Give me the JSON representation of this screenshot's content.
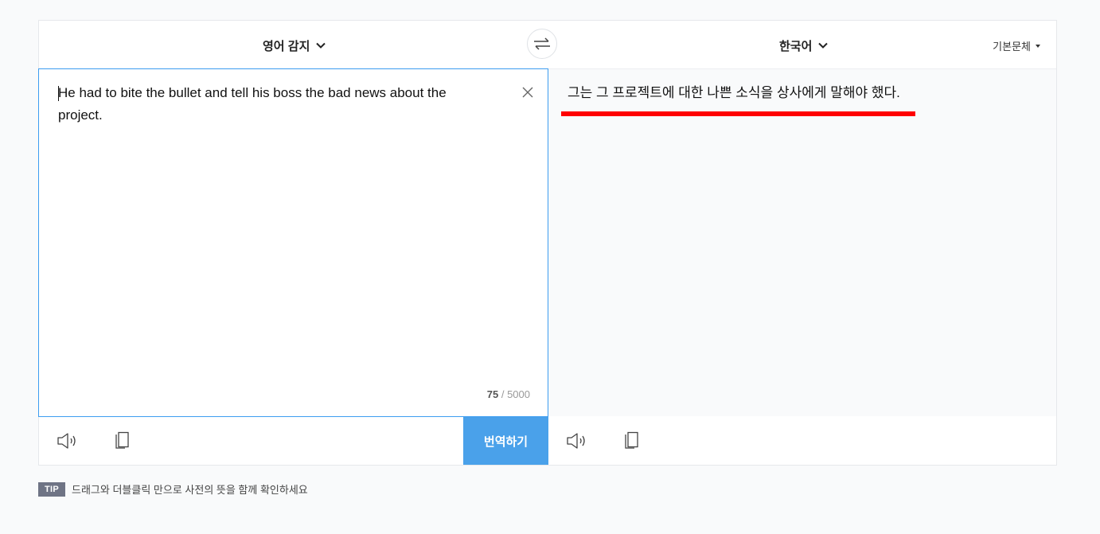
{
  "header": {
    "source_language": "영어 감지",
    "target_language": "한국어",
    "style_selector": "기본문체"
  },
  "source": {
    "text": "He had to bite the bullet and tell his boss the bad news about the project.",
    "char_count": "75",
    "char_limit": "/ 5000"
  },
  "target": {
    "text": "그는 그 프로젝트에 대한 나쁜 소식을 상사에게 말해야 했다."
  },
  "actions": {
    "translate_label": "번역하기"
  },
  "tip": {
    "badge": "TIP",
    "text": "드래그와 더블클릭 만으로 사전의 뜻을 함께 확인하세요"
  },
  "colors": {
    "accent": "#4aa1ea",
    "focus_border": "#3d9df1",
    "highlight_underline": "#ff0000"
  },
  "icons": [
    "chevron-down-icon",
    "swap-icon",
    "close-icon",
    "speaker-icon",
    "copy-icon"
  ]
}
